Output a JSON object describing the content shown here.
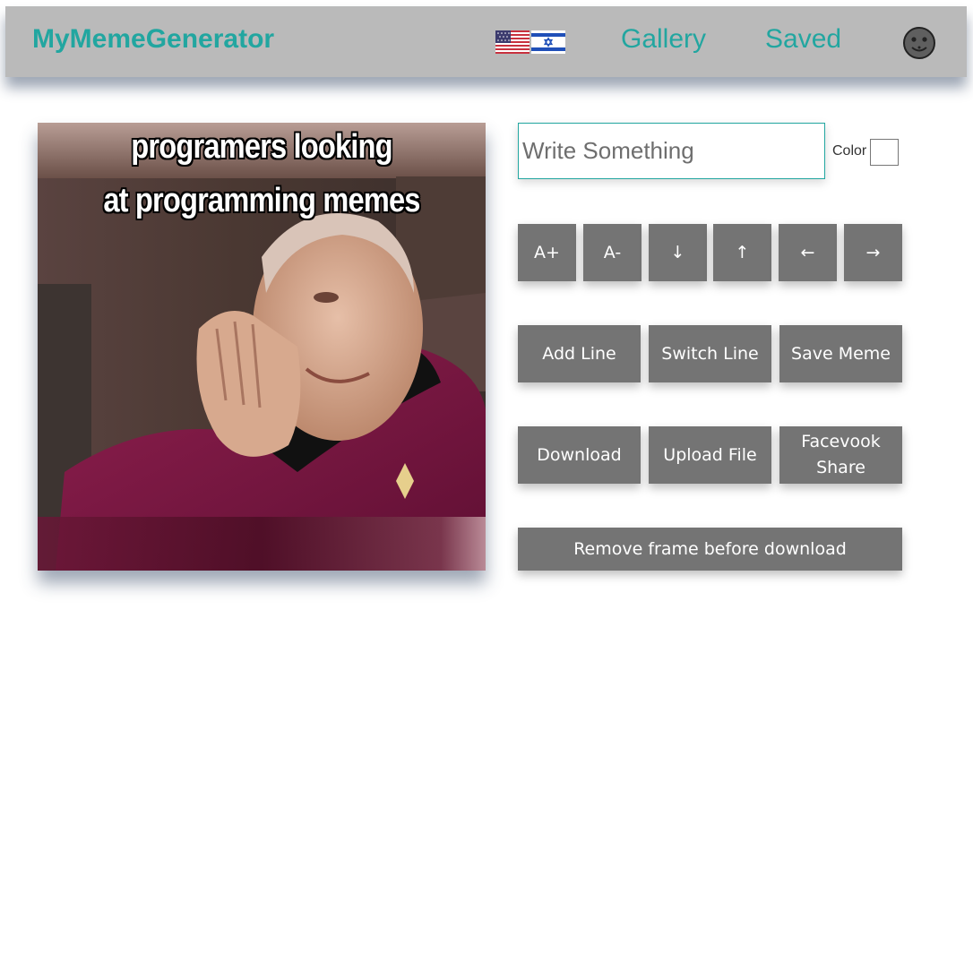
{
  "header": {
    "logo": "MyMemeGenerator",
    "nav": {
      "gallery": "Gallery",
      "saved": "Saved"
    },
    "languages": [
      "en-flag-icon",
      "he-flag-icon"
    ],
    "avatar_icon": "user-avatar-icon"
  },
  "meme": {
    "lines": [
      "programers looking",
      "at programming memes"
    ]
  },
  "editor": {
    "text_placeholder": "Write Something",
    "color_label": "Color",
    "color_value": "#ffffff",
    "controls": {
      "font_increase": "A+",
      "font_decrease": "A-",
      "move_down": "↓",
      "move_up": "↑",
      "align_left": "←",
      "align_right": "→"
    },
    "actions": {
      "add_line": "Add Line",
      "switch_line": "Switch Line",
      "save_meme": "Save Meme",
      "download": "Download",
      "upload_file": "Upload File",
      "facebook_share": "Facevook Share",
      "remove_frame": "Remove frame before download"
    }
  },
  "colors": {
    "accent": "#22a6a0",
    "header_bg": "#bababa",
    "button_bg": "#747474"
  }
}
